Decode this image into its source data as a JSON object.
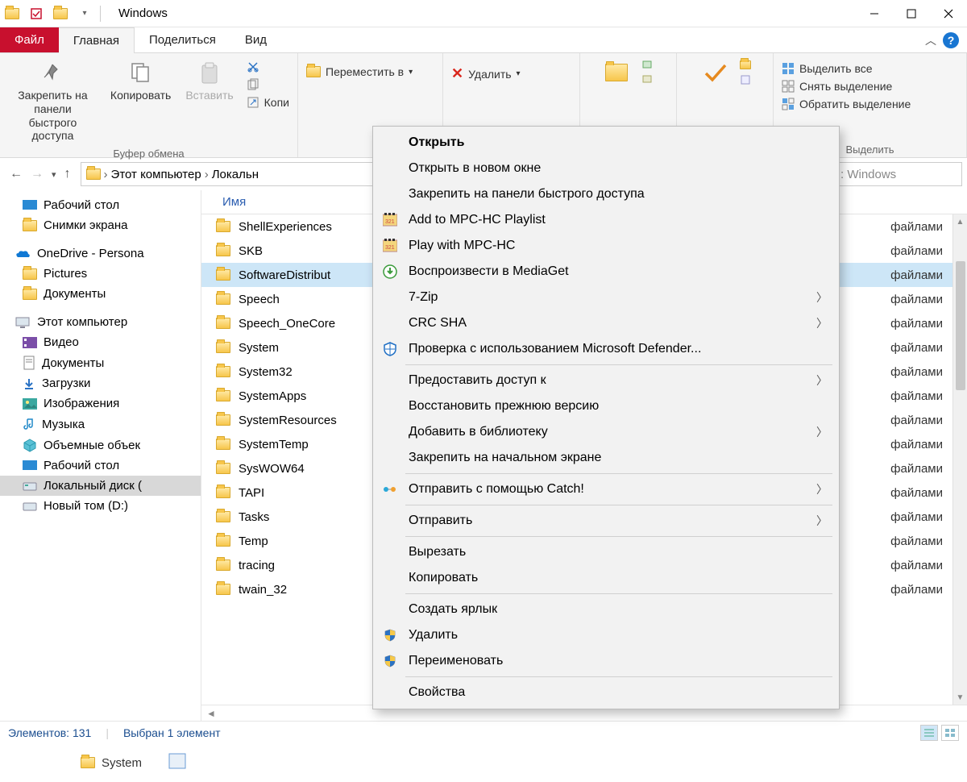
{
  "window": {
    "title": "Windows"
  },
  "tabs": {
    "file": "Файл",
    "home": "Главная",
    "share": "Поделиться",
    "view": "Вид"
  },
  "ribbon": {
    "clipboard": {
      "pin": "Закрепить на панели\nбыстрого доступа",
      "copy": "Копировать",
      "paste": "Вставить",
      "cut_small": "Копи",
      "group_label": "Буфер обмена"
    },
    "organize": {
      "move_to": "Переместить в",
      "delete": "Удалить"
    },
    "select": {
      "select_all": "Выделить все",
      "select_none": "Снять выделение",
      "invert": "Обратить выделение",
      "group_label": "Выделить"
    }
  },
  "breadcrumb": {
    "pc": "Этот компьютер",
    "drive": "Локальн"
  },
  "search": {
    "placeholder": ": Windows"
  },
  "nav": {
    "desktop": "Рабочий стол",
    "screenshots": "Снимки экрана",
    "onedrive": "OneDrive - Persona",
    "pictures": "Pictures",
    "documents_od": "Документы",
    "this_pc": "Этот компьютер",
    "videos": "Видео",
    "documents": "Документы",
    "downloads": "Загрузки",
    "images": "Изображения",
    "music": "Музыка",
    "objects3d": "Объемные объек",
    "desktop2": "Рабочий стол",
    "local_c": "Локальный диск (",
    "new_d": "Новый том (D:)"
  },
  "columns": {
    "name": "Имя",
    "type_value": "файлами"
  },
  "files": [
    {
      "name": "ShellExperiences"
    },
    {
      "name": "SKB"
    },
    {
      "name": "SoftwareDistribut",
      "selected": true
    },
    {
      "name": "Speech"
    },
    {
      "name": "Speech_OneCore"
    },
    {
      "name": "System"
    },
    {
      "name": "System32"
    },
    {
      "name": "SystemApps"
    },
    {
      "name": "SystemResources"
    },
    {
      "name": "SystemTemp"
    },
    {
      "name": "SysWOW64"
    },
    {
      "name": "TAPI"
    },
    {
      "name": "Tasks"
    },
    {
      "name": "Temp"
    },
    {
      "name": "tracing"
    },
    {
      "name": "twain_32"
    }
  ],
  "status": {
    "count": "Элементов: 131",
    "selected": "Выбран 1 элемент"
  },
  "ctx": {
    "open": "Открыть",
    "open_new": "Открыть в новом окне",
    "pin_qa": "Закрепить на панели быстрого доступа",
    "mpc_add": "Add to MPC-HC Playlist",
    "mpc_play": "Play with MPC-HC",
    "mediaget": "Воспроизвести в MediaGet",
    "sevenzip": "7-Zip",
    "crc": "CRC SHA",
    "defender": "Проверка с использованием Microsoft Defender...",
    "share_access": "Предоставить доступ к",
    "restore_prev": "Восстановить прежнюю версию",
    "add_library": "Добавить в библиотеку",
    "pin_start": "Закрепить на начальном экране",
    "catch": "Отправить с помощью Catch!",
    "send_to": "Отправить",
    "cut": "Вырезать",
    "copy": "Копировать",
    "create_shortcut": "Создать ярлык",
    "delete": "Удалить",
    "rename": "Переименовать",
    "properties": "Свойства"
  },
  "bottom": {
    "system": "System"
  }
}
